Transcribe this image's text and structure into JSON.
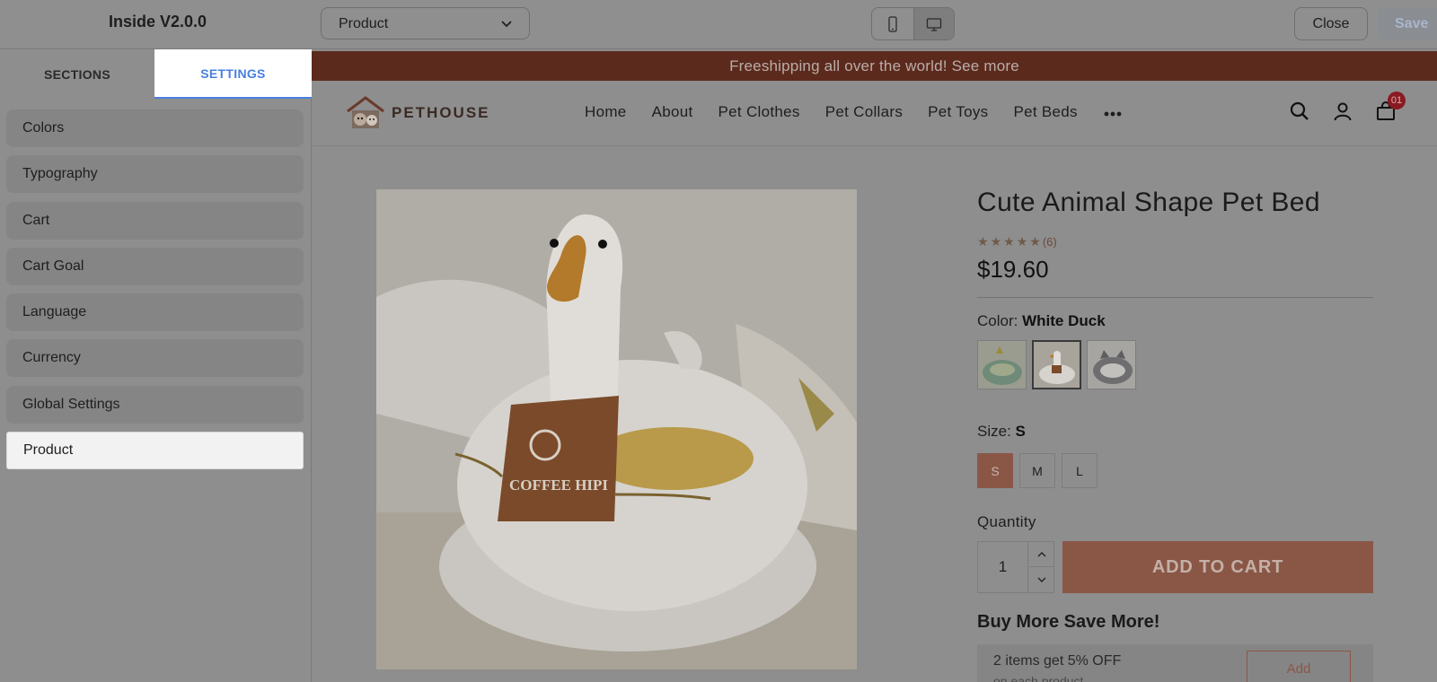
{
  "topbar": {
    "app_title": "Inside V2.0.0",
    "page_select": "Product",
    "close_label": "Close",
    "save_label": "Save"
  },
  "left_panel": {
    "tabs": [
      {
        "label": "SECTIONS",
        "active": false
      },
      {
        "label": "SETTINGS",
        "active": true
      }
    ],
    "items": [
      {
        "label": "Colors"
      },
      {
        "label": "Typography"
      },
      {
        "label": "Cart"
      },
      {
        "label": "Cart Goal"
      },
      {
        "label": "Language"
      },
      {
        "label": "Currency"
      },
      {
        "label": "Global Settings"
      },
      {
        "label": "Product",
        "active": true
      }
    ]
  },
  "store": {
    "announcement": "Freeshipping all over the world! See more",
    "logo_text": "PETHOUSE",
    "nav": [
      "Home",
      "About",
      "Pet Clothes",
      "Pet Collars",
      "Pet Toys",
      "Pet Beds"
    ],
    "cart_count": "01"
  },
  "product": {
    "title": "Cute Animal Shape Pet Bed",
    "rating_count": "(6)",
    "price": "$19.60",
    "color_label": "Color:",
    "color_value": "White Duck",
    "size_label": "Size:",
    "size_value": "S",
    "sizes": [
      "S",
      "M",
      "L"
    ],
    "quantity_label": "Quantity",
    "quantity": "1",
    "add_to_cart": "ADD TO CART",
    "apron_text": "COFFEE HIPI",
    "bundle_title": "Buy More Save More!",
    "bundle_offer": "2 items get 5% OFF",
    "bundle_sub": "on each product",
    "bundle_add": "Add"
  },
  "colors": {
    "accent": "#4a7fe0",
    "brand": "#8a5746",
    "announce_bg": "#5c2a1d",
    "badge": "#8a1a22"
  },
  "icons": [
    "chevron-down-icon",
    "mobile-icon",
    "desktop-icon",
    "more-icon",
    "search-icon",
    "user-icon",
    "cart-icon",
    "star-icon",
    "chevron-up-icon"
  ]
}
